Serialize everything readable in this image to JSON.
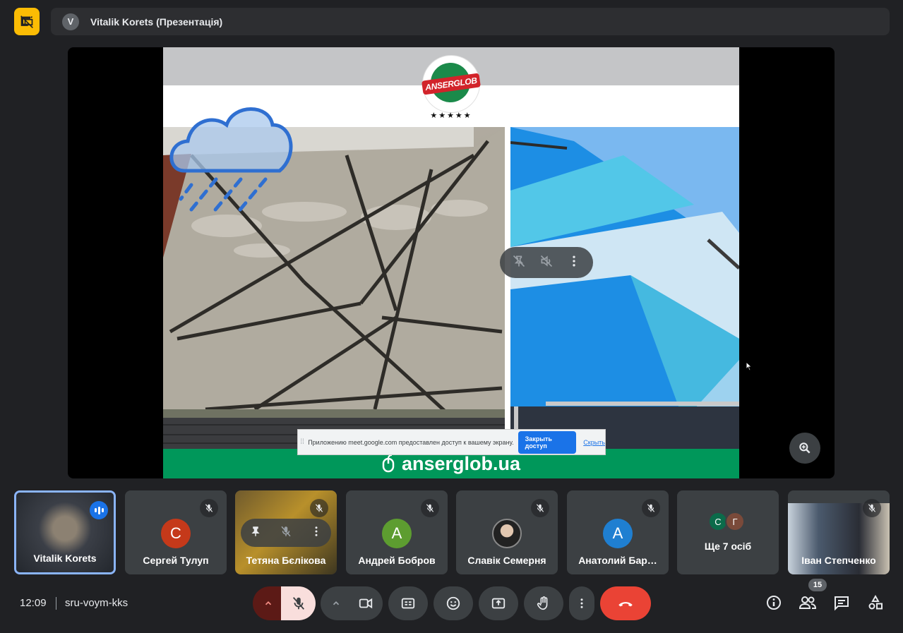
{
  "header": {
    "presenter_avatar_initial": "V",
    "title": "Vitalik Korets (Презентація)"
  },
  "slide": {
    "logo_text": "ANSERGLOB",
    "logo_stars": "★★★★★",
    "footer_url": "anserglob.ua"
  },
  "share_banner": {
    "message": "Приложению meet.google.com предоставлен доступ к вашему экрану.",
    "stop_label": "Закрыть доступ",
    "hide_label": "Скрыть"
  },
  "participants": [
    {
      "name": "Vitalik Korets",
      "initial": "",
      "color": "",
      "speaking": true
    },
    {
      "name": "Сергей Тулуп",
      "initial": "С",
      "color": "#c5391a",
      "muted": true
    },
    {
      "name": "Тетяна Бєлікова",
      "initial": "",
      "color": "",
      "muted": true
    },
    {
      "name": "Андрей Бобров",
      "initial": "А",
      "color": "#5d9d30",
      "muted": true
    },
    {
      "name": "Славік Семерня",
      "initial": "",
      "color": "",
      "muted": true
    },
    {
      "name": "Анатолий Бар…",
      "initial": "А",
      "color": "#1f7fd1",
      "muted": true
    },
    {
      "name": "Ще 7 осіб",
      "initials": [
        "С",
        "Г"
      ],
      "colors": [
        "#0b6b4a",
        "#7a4a3a"
      ]
    },
    {
      "name": "Іван Степченко",
      "initial": "",
      "color": "",
      "muted": true
    }
  ],
  "bottom_bar": {
    "time": "12:09",
    "meeting_code": "sru-voym-kks",
    "participants_count": "15"
  },
  "icons": {
    "present_toggle": "present-off-icon",
    "zoom": "zoom-in-icon",
    "mic": "mic-off-icon",
    "camera": "camera-icon",
    "captions": "captions-icon",
    "emoji": "emoji-icon",
    "present": "present-screen-icon",
    "hand": "raise-hand-icon",
    "more": "more-vert-icon",
    "leave": "call-end-icon",
    "info": "info-icon",
    "people": "people-icon",
    "chat": "chat-icon",
    "activities": "activities-icon"
  },
  "colors": {
    "background": "#202124",
    "accent_yellow": "#fbbc04",
    "leave_red": "#ea4335",
    "mic_off_bg": "#f9dedc",
    "brand_green": "#00975a"
  }
}
